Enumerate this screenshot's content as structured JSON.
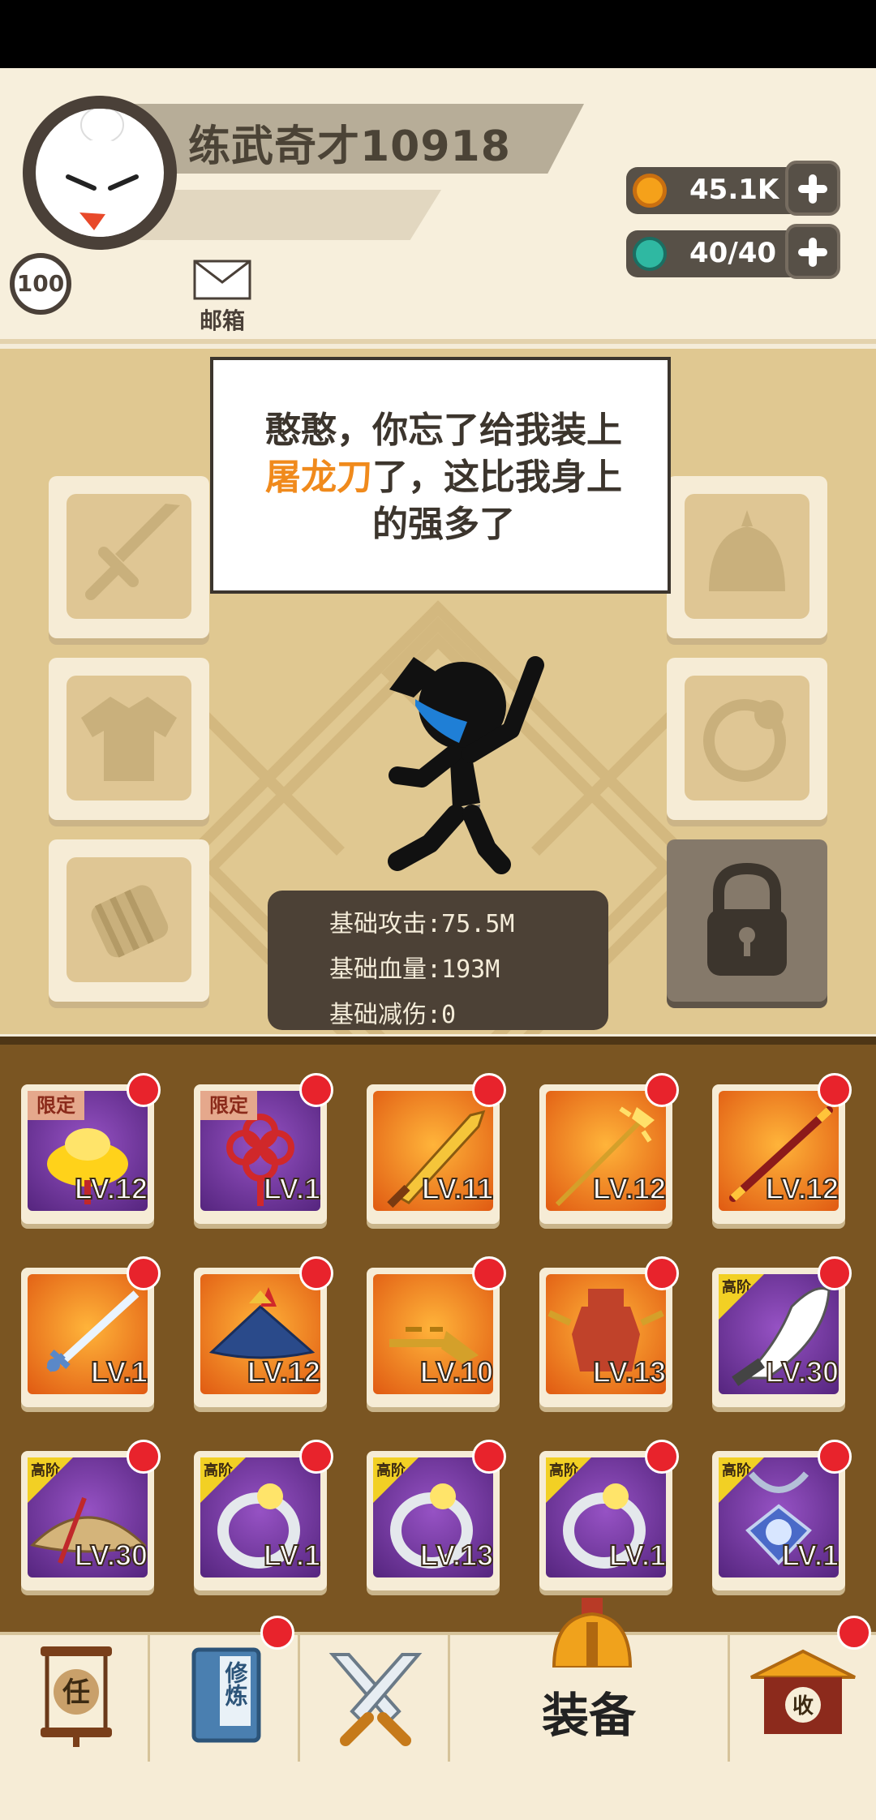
{
  "player": {
    "name": "练武奇才10918",
    "level": "100"
  },
  "mail": {
    "label": "邮箱"
  },
  "resources": {
    "gold": "45.1K",
    "energy": "40/40"
  },
  "dialog": {
    "line1": "憨憨，你忘了给我装上",
    "highlight": "屠龙刀",
    "line2_rest": "了，这比我身上",
    "line3": "的强多了"
  },
  "stats": {
    "attack": "基础攻击:75.5M",
    "hp": "基础血量:193M",
    "reduction": "基础减伤:0"
  },
  "equipment_slots": [
    "weapon",
    "helmet",
    "armor",
    "ring",
    "bracer",
    "locked"
  ],
  "inventory": [
    {
      "name": "gold-ingot",
      "level": "LV.12",
      "tag": "限定",
      "bg": "purple"
    },
    {
      "name": "chinese-knot",
      "level": "LV.1",
      "tag": "限定",
      "bg": "purple"
    },
    {
      "name": "dragon-blade",
      "level": "LV.11",
      "tag": "",
      "bg": "orange"
    },
    {
      "name": "golden-spear",
      "level": "LV.12",
      "tag": "",
      "bg": "orange"
    },
    {
      "name": "red-staff",
      "level": "LV.12",
      "tag": "",
      "bg": "orange"
    },
    {
      "name": "ice-sword",
      "level": "LV.1",
      "tag": "",
      "bg": "orange"
    },
    {
      "name": "blue-hat",
      "level": "LV.12",
      "tag": "",
      "bg": "orange"
    },
    {
      "name": "golden-key",
      "level": "LV.10",
      "tag": "",
      "bg": "orange"
    },
    {
      "name": "red-armor",
      "level": "LV.13",
      "tag": "",
      "bg": "orange"
    },
    {
      "name": "broad-saber",
      "level": "LV.30",
      "tag": "高阶",
      "bg": "purple"
    },
    {
      "name": "straw-hat",
      "level": "LV.30",
      "tag": "高阶",
      "bg": "purple"
    },
    {
      "name": "silver-ring",
      "level": "LV.1",
      "tag": "高阶",
      "bg": "purple"
    },
    {
      "name": "silver-ring",
      "level": "LV.13",
      "tag": "高阶",
      "bg": "purple"
    },
    {
      "name": "silver-ring",
      "level": "LV.1",
      "tag": "高阶",
      "bg": "purple"
    },
    {
      "name": "gem-amulet",
      "level": "LV.1",
      "tag": "高阶",
      "bg": "purple"
    }
  ],
  "nav": {
    "task": {
      "glyph": "任"
    },
    "train": {
      "glyph": "修炼"
    },
    "battle": {},
    "equip": {
      "label": "装备"
    },
    "collect": {
      "glyph": "收"
    }
  }
}
